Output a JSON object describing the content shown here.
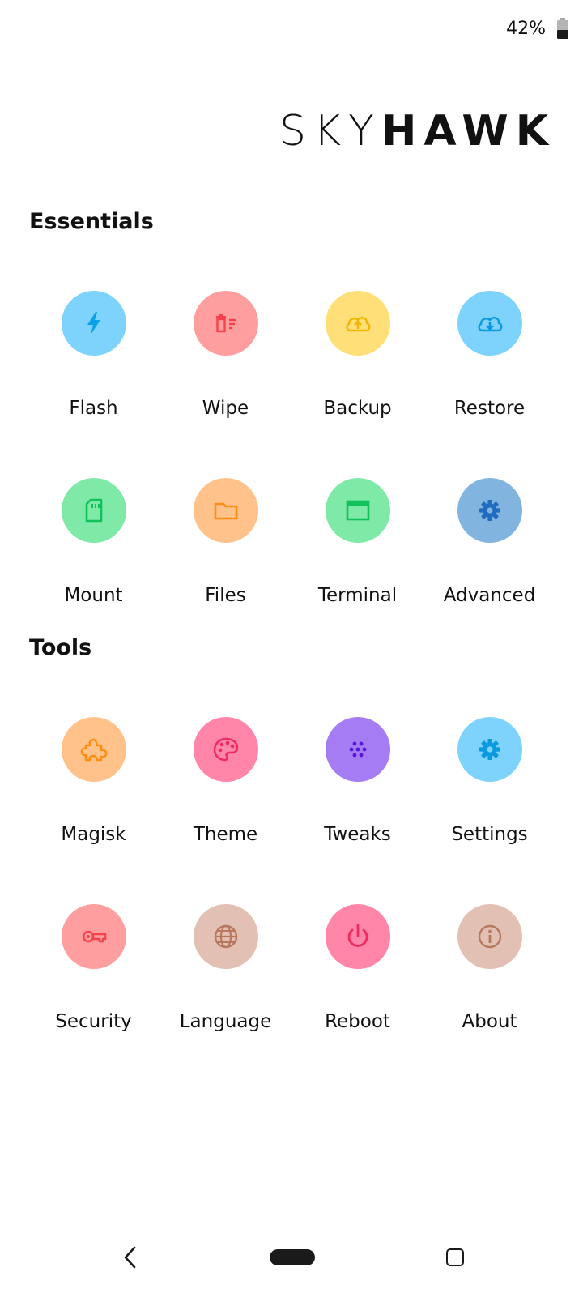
{
  "status_bar": {
    "battery_percent": "42%"
  },
  "logo": {
    "part1": "SKY",
    "part2": "HAWK"
  },
  "essentials": {
    "title": "Essentials",
    "items": [
      {
        "label": "Flash",
        "icon": "flash-icon",
        "bg": "#7dd3fb",
        "fg": "#0aa1e8"
      },
      {
        "label": "Wipe",
        "icon": "wipe-icon",
        "bg": "#ff9e9e",
        "fg": "#f5424d"
      },
      {
        "label": "Backup",
        "icon": "cloud-upload-icon",
        "bg": "#ffdf77",
        "fg": "#f2b500"
      },
      {
        "label": "Restore",
        "icon": "cloud-download-icon",
        "bg": "#7dd3fb",
        "fg": "#0a98e0"
      },
      {
        "label": "Mount",
        "icon": "sd-card-icon",
        "bg": "#7fe9a8",
        "fg": "#11c15a"
      },
      {
        "label": "Files",
        "icon": "folder-icon",
        "bg": "#ffc28a",
        "fg": "#ff8d12"
      },
      {
        "label": "Terminal",
        "icon": "terminal-window-icon",
        "bg": "#7fe9a8",
        "fg": "#11c15a"
      },
      {
        "label": "Advanced",
        "icon": "gear-icon",
        "bg": "#82b4e0",
        "fg": "#1f6cc0"
      }
    ]
  },
  "tools": {
    "title": "Tools",
    "items": [
      {
        "label": "Magisk",
        "icon": "puzzle-icon",
        "bg": "#ffc28a",
        "fg": "#ff8d12"
      },
      {
        "label": "Theme",
        "icon": "palette-icon",
        "bg": "#ff86a8",
        "fg": "#f0295f"
      },
      {
        "label": "Tweaks",
        "icon": "dots-icon",
        "bg": "#a57cf4",
        "fg": "#5a16d6"
      },
      {
        "label": "Settings",
        "icon": "gear-icon",
        "bg": "#7dd3fb",
        "fg": "#0a98e0"
      },
      {
        "label": "Security",
        "icon": "key-icon",
        "bg": "#ff9e9e",
        "fg": "#f5424d"
      },
      {
        "label": "Language",
        "icon": "globe-icon",
        "bg": "#e2c0b3",
        "fg": "#b8775f"
      },
      {
        "label": "Reboot",
        "icon": "power-icon",
        "bg": "#ff86a8",
        "fg": "#f0295f"
      },
      {
        "label": "About",
        "icon": "info-icon",
        "bg": "#e2c0b3",
        "fg": "#b8775f"
      }
    ]
  },
  "nav": {
    "back": "back-icon",
    "home": "home-pill",
    "recents": "recents-icon"
  }
}
